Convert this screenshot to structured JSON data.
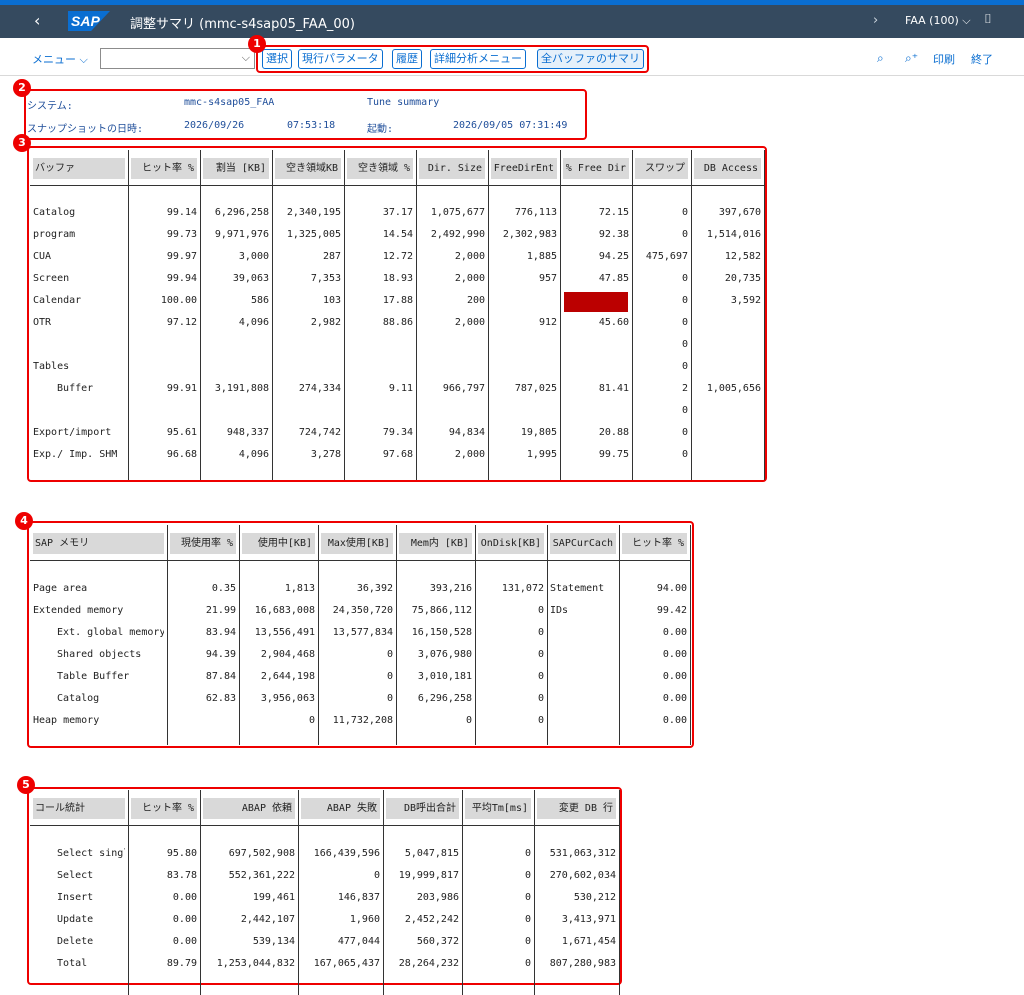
{
  "shell": {
    "title": "調整サマリ (mmc-s4sap05_FAA_00)",
    "system": "FAA (100)",
    "back_glyph": "‹",
    "logo": "SAP"
  },
  "toolbar": {
    "menu": "メニュー",
    "buttons": [
      "選択",
      "現行パラメータ",
      "履歴",
      "詳細分析メニュー",
      "全バッファのサマリ"
    ],
    "right": [
      "印刷",
      "終了"
    ]
  },
  "badges": [
    "1",
    "2",
    "3",
    "4",
    "5"
  ],
  "header": {
    "system_label": "システム:",
    "system_value": "mmc-s4sap05_FAA",
    "tune": "Tune summary",
    "snapshot_label": "スナップショットの日時:",
    "snapshot_date": "2026/09/26",
    "snapshot_time": "07:53:18",
    "start_label": "起動:",
    "start_value": "2026/09/05 07:31:49"
  },
  "buffer_table": {
    "headers": [
      "バッファ",
      "ヒット率 %",
      "割当 [KB]",
      "空き領域KB",
      "空き領域 %",
      "Dir. Size",
      "FreeDirEnt",
      "% Free Dir",
      "スワップ",
      "DB Access"
    ],
    "rows": [
      [
        "Catalog",
        "99.14",
        "6,296,258",
        "2,340,195",
        "37.17",
        "1,075,677",
        "776,113",
        "72.15",
        "0",
        "397,670"
      ],
      [
        "program",
        "99.73",
        "9,971,976",
        "1,325,005",
        "14.54",
        "2,492,990",
        "2,302,983",
        "92.38",
        "0",
        "1,514,016"
      ],
      [
        "CUA",
        "99.97",
        "3,000",
        "287",
        "12.72",
        "2,000",
        "1,885",
        "94.25",
        "475,697",
        "12,582"
      ],
      [
        "Screen",
        "99.94",
        "39,063",
        "7,353",
        "18.93",
        "2,000",
        "957",
        "47.85",
        "0",
        "20,735"
      ],
      [
        "Calendar",
        "100.00",
        "586",
        "103",
        "17.88",
        "200",
        "",
        "",
        "0",
        "3,592"
      ],
      [
        "OTR",
        "97.12",
        "4,096",
        "2,982",
        "88.86",
        "2,000",
        "912",
        "45.60",
        "0",
        ""
      ],
      [
        "",
        "",
        "",
        "",
        "",
        "",
        "",
        "",
        "0",
        ""
      ],
      [
        "Tables",
        "",
        "",
        "",
        "",
        "",
        "",
        "",
        "0",
        ""
      ],
      [
        "  Buffer",
        "99.91",
        "3,191,808",
        "274,334",
        "9.11",
        "966,797",
        "787,025",
        "81.41",
        "2",
        "1,005,656"
      ],
      [
        "",
        "",
        "",
        "",
        "",
        "",
        "",
        "",
        "0",
        ""
      ],
      [
        "Export/import",
        "95.61",
        "948,337",
        "724,742",
        "79.34",
        "94,834",
        "19,805",
        "20.88",
        "0",
        ""
      ],
      [
        "Exp./ Imp. SHM",
        "96.68",
        "4,096",
        "3,278",
        "97.68",
        "2,000",
        "1,995",
        "99.75",
        "0",
        ""
      ]
    ],
    "alert_color": "#bb0000"
  },
  "memory_table": {
    "headers": [
      "SAP メモリ",
      "現使用率 %",
      "使用中[KB]",
      "Max使用[KB]",
      "Mem内 [KB]",
      "OnDisk[KB]",
      "SAPCurCach",
      "ヒット率 %"
    ],
    "rows": [
      [
        "Page area",
        "0.35",
        "1,813",
        "36,392",
        "393,216",
        "131,072",
        "Statement",
        "94.00"
      ],
      [
        "Extended memory",
        "21.99",
        "16,683,008",
        "24,350,720",
        "75,866,112",
        "0",
        "IDs",
        "99.42"
      ],
      [
        "  Ext. global memory",
        "83.94",
        "13,556,491",
        "13,577,834",
        "16,150,528",
        "0",
        "",
        "0.00"
      ],
      [
        "  Shared objects",
        "94.39",
        "2,904,468",
        "0",
        "3,076,980",
        "0",
        "",
        "0.00"
      ],
      [
        "  Table Buffer",
        "87.84",
        "2,644,198",
        "0",
        "3,010,181",
        "0",
        "",
        "0.00"
      ],
      [
        "  Catalog",
        "62.83",
        "3,956,063",
        "0",
        "6,296,258",
        "0",
        "",
        "0.00"
      ],
      [
        "Heap memory",
        "",
        "0",
        "11,732,208",
        "0",
        "0",
        "",
        "0.00"
      ]
    ]
  },
  "call_table": {
    "headers": [
      "コール統計",
      "ヒット率 %",
      "ABAP 依頼",
      "ABAP 失敗",
      "DB呼出合計",
      "平均Tm[ms]",
      "変更 DB 行"
    ],
    "rows": [
      [
        "  Select single",
        "95.80",
        "697,502,908",
        "166,439,596",
        "5,047,815",
        "0",
        "531,063,312"
      ],
      [
        "  Select",
        "83.78",
        "552,361,222",
        "0",
        "19,999,817",
        "0",
        "270,602,034"
      ],
      [
        "  Insert",
        "0.00",
        "199,461",
        "146,837",
        "203,986",
        "0",
        "530,212"
      ],
      [
        "  Update",
        "0.00",
        "2,442,107",
        "1,960",
        "2,452,242",
        "0",
        "3,413,971"
      ],
      [
        "  Delete",
        "0.00",
        "539,134",
        "477,044",
        "560,372",
        "0",
        "1,671,454"
      ],
      [
        "  Total",
        "89.79",
        "1,253,044,832",
        "167,065,437",
        "28,264,232",
        "0",
        "807,280,983"
      ]
    ]
  }
}
